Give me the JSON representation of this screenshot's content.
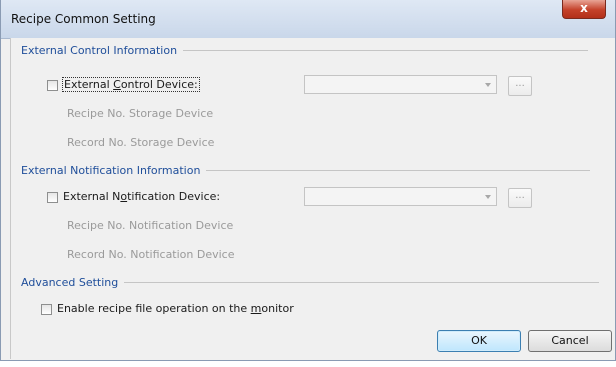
{
  "window": {
    "title": "Recipe Common Setting",
    "close_glyph": "x"
  },
  "external_control": {
    "header": "External Control Information",
    "checkbox_label_pre": "External ",
    "checkbox_label_ul": "C",
    "checkbox_label_post": "ontrol Device:",
    "checked": false,
    "device_value": "",
    "browse_label": "...",
    "recipe_no_label": "Recipe No. Storage Device",
    "record_no_label": "Record No. Storage Device"
  },
  "external_notification": {
    "header": "External Notification Information",
    "checkbox_label_pre": "External N",
    "checkbox_label_ul": "o",
    "checkbox_label_post": "tification Device:",
    "checked": false,
    "device_value": "",
    "browse_label": "...",
    "recipe_no_label": "Recipe No. Notification Device",
    "record_no_label": "Record No. Notification Device"
  },
  "advanced": {
    "header": "Advanced Setting",
    "checkbox_label_pre": "Enable recipe file operation on the ",
    "checkbox_label_ul": "m",
    "checkbox_label_post": "onitor",
    "checked": false
  },
  "buttons": {
    "ok_label": "OK",
    "cancel_label": "Cancel"
  },
  "colors": {
    "section_header": "#1f4e9a",
    "close_button": "#c4412a",
    "disabled_text": "#9a9a9a"
  }
}
